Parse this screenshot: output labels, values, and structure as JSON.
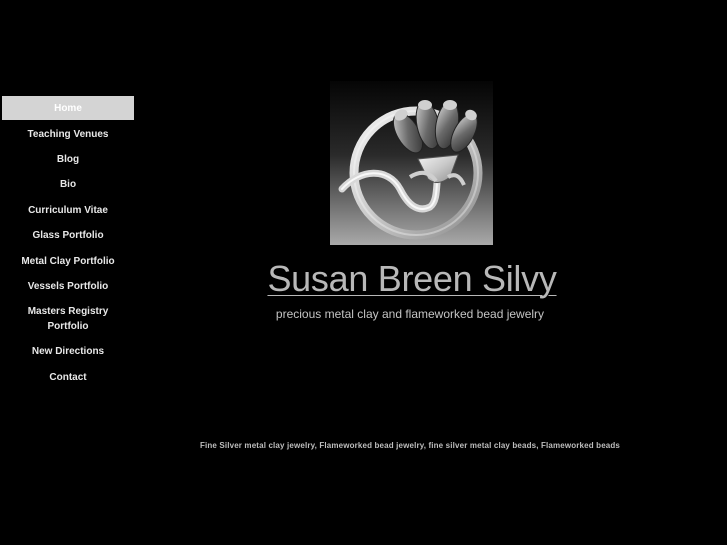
{
  "nav": {
    "items": [
      {
        "label": "Home",
        "active": true
      },
      {
        "label": "Teaching Venues"
      },
      {
        "label": "Blog"
      },
      {
        "label": "Bio"
      },
      {
        "label": "Curriculum Vitae"
      },
      {
        "label": "Glass Portfolio"
      },
      {
        "label": "Metal Clay Portfolio"
      },
      {
        "label": "Vessels Portfolio"
      },
      {
        "label": "Masters Registry Portfolio"
      },
      {
        "label": "New Directions"
      },
      {
        "label": "Contact"
      }
    ]
  },
  "header": {
    "title": "Susan Breen Silvy",
    "tagline": "precious metal clay and flameworked bead jewelry"
  },
  "footer": {
    "keywords": "Fine Silver metal clay jewelry, Flameworked bead jewelry, fine silver metal clay beads, Flameworked beads"
  },
  "colors": {
    "background": "#000000",
    "nav_active_bg": "#d4d4d4",
    "title": "#b8b8b8"
  }
}
